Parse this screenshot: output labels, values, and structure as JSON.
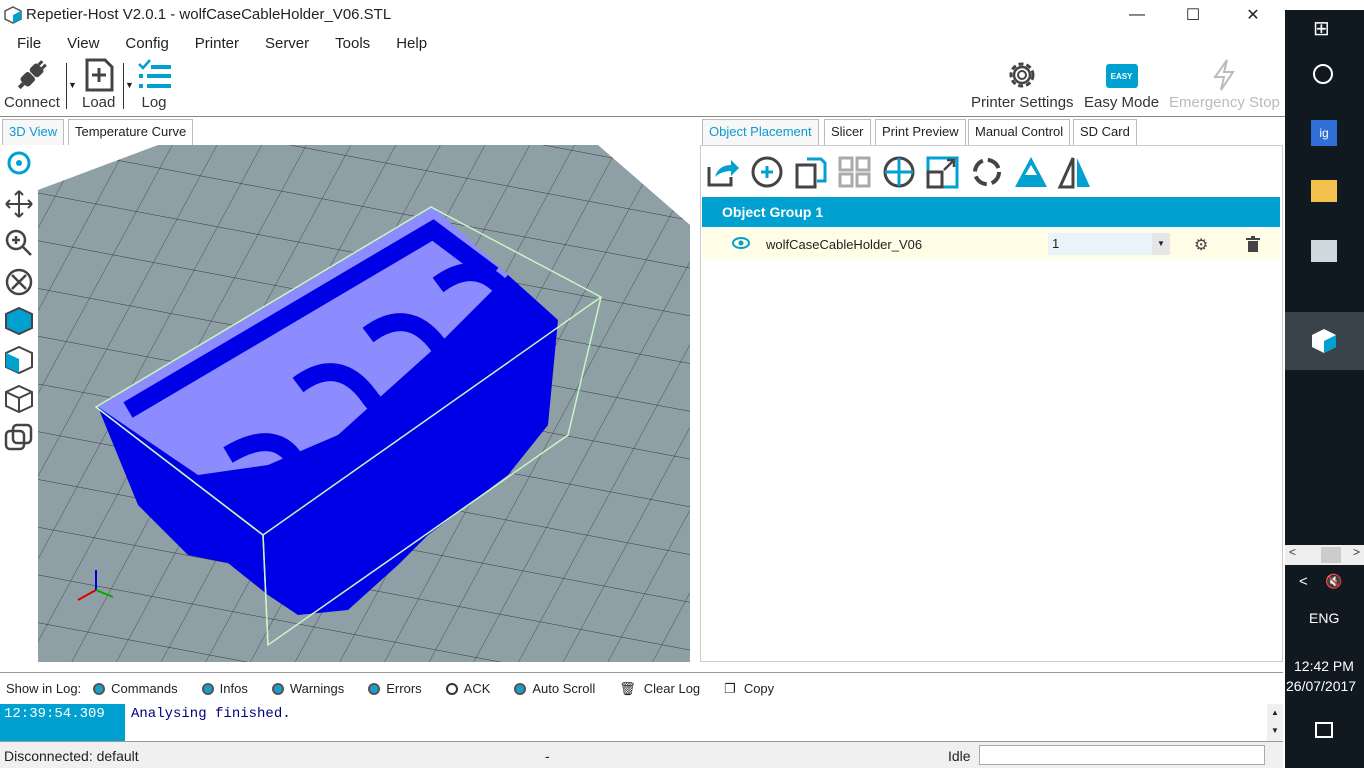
{
  "window": {
    "title": "Repetier-Host V2.0.1 - wolfCaseCableHolder_V06.STL",
    "minimize": "—",
    "maximize": "☐",
    "close": "✕"
  },
  "menu": [
    "File",
    "View",
    "Config",
    "Printer",
    "Server",
    "Tools",
    "Help"
  ],
  "toolbar": {
    "connect": "Connect",
    "load": "Load",
    "log": "Log",
    "printer_settings": "Printer Settings",
    "easy_mode": "Easy Mode",
    "easy_badge": "EASY",
    "emergency_stop": "Emergency Stop"
  },
  "left_tabs": [
    "3D View",
    "Temperature Curve"
  ],
  "right_tabs": [
    "Object Placement",
    "Slicer",
    "Print Preview",
    "Manual Control",
    "SD Card"
  ],
  "object_group": {
    "title": "Object Group 1",
    "objects": [
      {
        "name": "wolfCaseCableHolder_V06",
        "copies": "1"
      }
    ]
  },
  "log": {
    "show_label": "Show in Log:",
    "filters": [
      {
        "label": "Commands",
        "on": true
      },
      {
        "label": "Infos",
        "on": true
      },
      {
        "label": "Warnings",
        "on": true
      },
      {
        "label": "Errors",
        "on": true
      },
      {
        "label": "ACK",
        "on": false
      },
      {
        "label": "Auto Scroll",
        "on": true
      }
    ],
    "clear": "Clear Log",
    "copy": "Copy",
    "entries": [
      {
        "time": "12:39:54.309",
        "text": "Analysing finished."
      }
    ]
  },
  "status": {
    "connection": "Disconnected: default",
    "middle": "-",
    "state": "Idle"
  },
  "taskbar": {
    "lang": "ENG",
    "time": "12:42 PM",
    "date": "26/07/2017"
  },
  "colors": {
    "accent": "#00a1d1",
    "model": "#0000e6",
    "model_top": "#8c8cff",
    "bed": "#8e9fa5"
  }
}
